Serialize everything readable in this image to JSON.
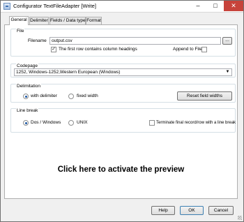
{
  "window": {
    "title": "Configurator TextFileAdapter  [Write]"
  },
  "tabs": [
    {
      "label": "General"
    },
    {
      "label": "Delimiter"
    },
    {
      "label": "Fields / Data types"
    },
    {
      "label": "Format"
    }
  ],
  "file": {
    "group_title": "File",
    "filename_label": "Filename",
    "filename_value": "output.csv",
    "browse_label": "...",
    "headings_label": "The first row contains column headings",
    "headings_checked": true,
    "append_label": "Append to File",
    "append_checked": false
  },
  "codepage": {
    "group_title": "Codepage",
    "selected": "1252, Windows-1252,Western European (Windows)"
  },
  "delimitation": {
    "group_title": "Delimitation",
    "with_delimiter_label": "with delimiter",
    "fixed_width_label": "fixed width",
    "selected": "with delimiter",
    "reset_button": "Reset field widths"
  },
  "line_break": {
    "group_title": "Line break",
    "dos_label": "Dos / Windows",
    "unix_label": "UNIX",
    "selected": "Dos / Windows",
    "terminate_label": "Terminate final record/row with a line break",
    "terminate_checked": false
  },
  "preview": {
    "message": "Click here to activate the preview"
  },
  "footer": {
    "help": "Help",
    "ok": "OK",
    "cancel": "Cancel"
  },
  "icons": {
    "minimize": "minimize-icon",
    "maximize": "maximize-icon",
    "close": "close-icon",
    "dropdown": "chevron-down-icon"
  }
}
